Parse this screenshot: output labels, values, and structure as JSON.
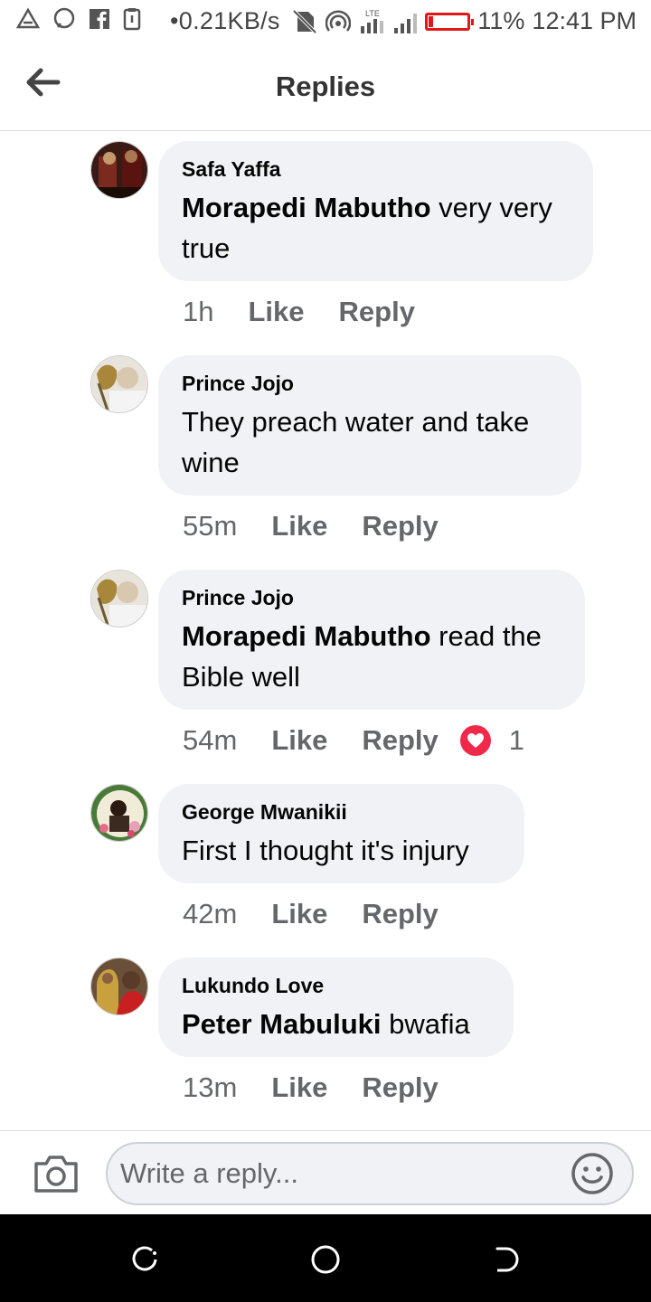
{
  "status_bar": {
    "network_speed": "0.21KB/s",
    "lte_label": "LTE",
    "battery_percent": "11%",
    "time": "12:41 PM",
    "battery_level": 0.11,
    "battery_color": "#e01818"
  },
  "header": {
    "title": "Replies",
    "back_icon": "arrow-left-icon"
  },
  "comments": [
    {
      "author": "Safa Yaffa",
      "mention": "Morapedi Mabutho",
      "text": " very very true",
      "time": "1h",
      "like_label": "Like",
      "reply_label": "Reply"
    },
    {
      "author": "Prince Jojo",
      "mention": "",
      "text": "They preach water and take wine",
      "time": "55m",
      "like_label": "Like",
      "reply_label": "Reply"
    },
    {
      "author": "Prince Jojo",
      "mention": "Morapedi Mabutho",
      "text": " read the Bible well",
      "time": "54m",
      "like_label": "Like",
      "reply_label": "Reply",
      "reaction_icon": "heart-icon",
      "reaction_count": "1"
    },
    {
      "author": "George Mwanikii",
      "mention": "",
      "text": "First I thought it's injury",
      "time": "42m",
      "like_label": "Like",
      "reply_label": "Reply"
    },
    {
      "author": "Lukundo Love",
      "mention": "Peter Mabuluki",
      "text": " bwafia",
      "time": "13m",
      "like_label": "Like",
      "reply_label": "Reply"
    }
  ],
  "composer": {
    "placeholder": "Write a reply...",
    "camera_icon": "camera-icon",
    "emoji_icon": "smiley-icon"
  },
  "nav_bar": {
    "icons": [
      "recent-apps-icon",
      "home-icon",
      "back-icon"
    ]
  },
  "colors": {
    "accent_heart": "#f0284a",
    "bubble_bg": "#f0f2f5",
    "secondary_text": "#65676b"
  }
}
